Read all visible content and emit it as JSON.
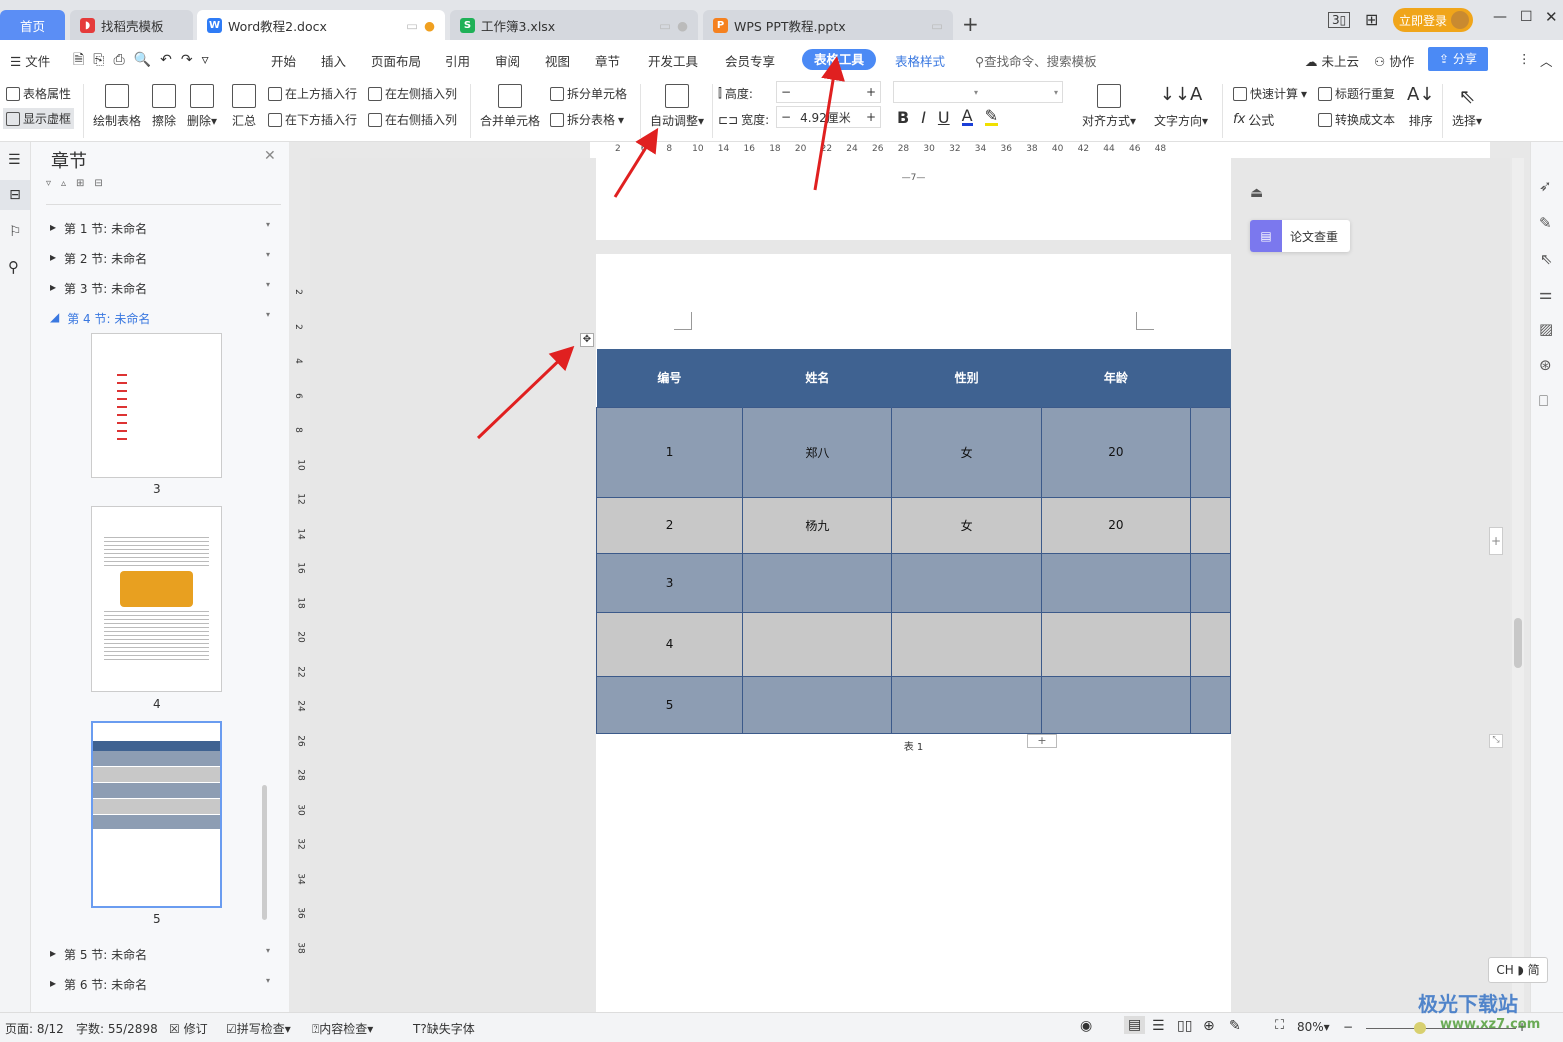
{
  "tabs": [
    {
      "label": "首页",
      "icon": "home"
    },
    {
      "label": "找稻壳模板",
      "icon": "docer-icon",
      "color": "#e53b3b"
    },
    {
      "label": "Word教程2.docx",
      "icon": "W",
      "color": "#2f7cf6",
      "active": true
    },
    {
      "label": "工作簿3.xlsx",
      "icon": "S",
      "color": "#1fb157"
    },
    {
      "label": "WPS PPT教程.pptx",
      "icon": "P",
      "color": "#f5811f"
    }
  ],
  "window": {
    "login": "立即登录",
    "new_tab": "+"
  },
  "menu": {
    "file": "文件",
    "items": [
      "开始",
      "插入",
      "页面布局",
      "引用",
      "审阅",
      "视图",
      "章节",
      "开发工具",
      "会员专享",
      "表格工具",
      "表格样式"
    ],
    "active": "表格工具",
    "search": "查找命令、搜索模板",
    "cloud": "未上云",
    "collab": "协作",
    "share": "分享"
  },
  "ribbon": {
    "table_props": "表格属性",
    "show_grid": "显示虚框",
    "draw": "绘制表格",
    "erase": "擦除",
    "delete": "删除",
    "summary": "汇总",
    "ins_above": "在上方插入行",
    "ins_below": "在下方插入行",
    "ins_left": "在左侧插入列",
    "ins_right": "在右侧插入列",
    "merge": "合并单元格",
    "split_cell": "拆分单元格",
    "split_table": "拆分表格",
    "autofit": "自动调整",
    "height": "高度:",
    "width": "宽度:",
    "width_value": "4.92厘米",
    "align": "对齐方式",
    "text_dir": "文字方向",
    "quick_calc": "快速计算",
    "formula": "公式",
    "repeat_header": "标题行重复",
    "to_text": "转换成文本",
    "sort": "排序",
    "select": "选择"
  },
  "nav": {
    "title": "章节",
    "sections": [
      "第 1 节: 未命名",
      "第 2 节: 未命名",
      "第 3 节: 未命名",
      "第 4 节: 未命名",
      "第 5 节: 未命名",
      "第 6 节: 未命名"
    ],
    "active_section": "第 4 节: 未命名",
    "pages": [
      "3",
      "4",
      "5"
    ]
  },
  "ruler": {
    "h_ticks": [
      "2",
      "6",
      "8",
      "10",
      "14",
      "16",
      "18",
      "20",
      "22",
      "24",
      "26",
      "28",
      "30",
      "32",
      "34",
      "36",
      "38",
      "40",
      "42",
      "44",
      "46",
      "48"
    ],
    "v_ticks": [
      "2",
      "2",
      "4",
      "6",
      "8",
      "10",
      "12",
      "14",
      "16",
      "18",
      "20",
      "22",
      "24",
      "26",
      "28",
      "30",
      "32",
      "34",
      "36",
      "38"
    ]
  },
  "doc": {
    "page_number": "—7—",
    "caption": "表 1",
    "table": {
      "headers": [
        "编号",
        "姓名",
        "性别",
        "年龄",
        ""
      ],
      "rows": [
        [
          "1",
          "郑八",
          "女",
          "20",
          ""
        ],
        [
          "2",
          "杨九",
          "女",
          "20",
          ""
        ],
        [
          "3",
          "",
          "",
          "",
          ""
        ],
        [
          "4",
          "",
          "",
          "",
          ""
        ],
        [
          "5",
          "",
          "",
          "",
          ""
        ]
      ]
    },
    "header_color": "#3f6291",
    "row_colors": [
      "#8d9db3",
      "#c8c8c8"
    ]
  },
  "side": {
    "paper_check": "论文查重",
    "ime": "CH ◗ 简"
  },
  "status": {
    "page": "页面: 8/12",
    "words": "字数: 55/2898",
    "revise": "修订",
    "spell": "拼写检查",
    "content": "内容检查",
    "missing_font": "缺失字体",
    "zoom": "80%"
  },
  "watermark": {
    "text": "极光下载站",
    "url": "www.xz7.com"
  },
  "accent": "#4b8af5"
}
